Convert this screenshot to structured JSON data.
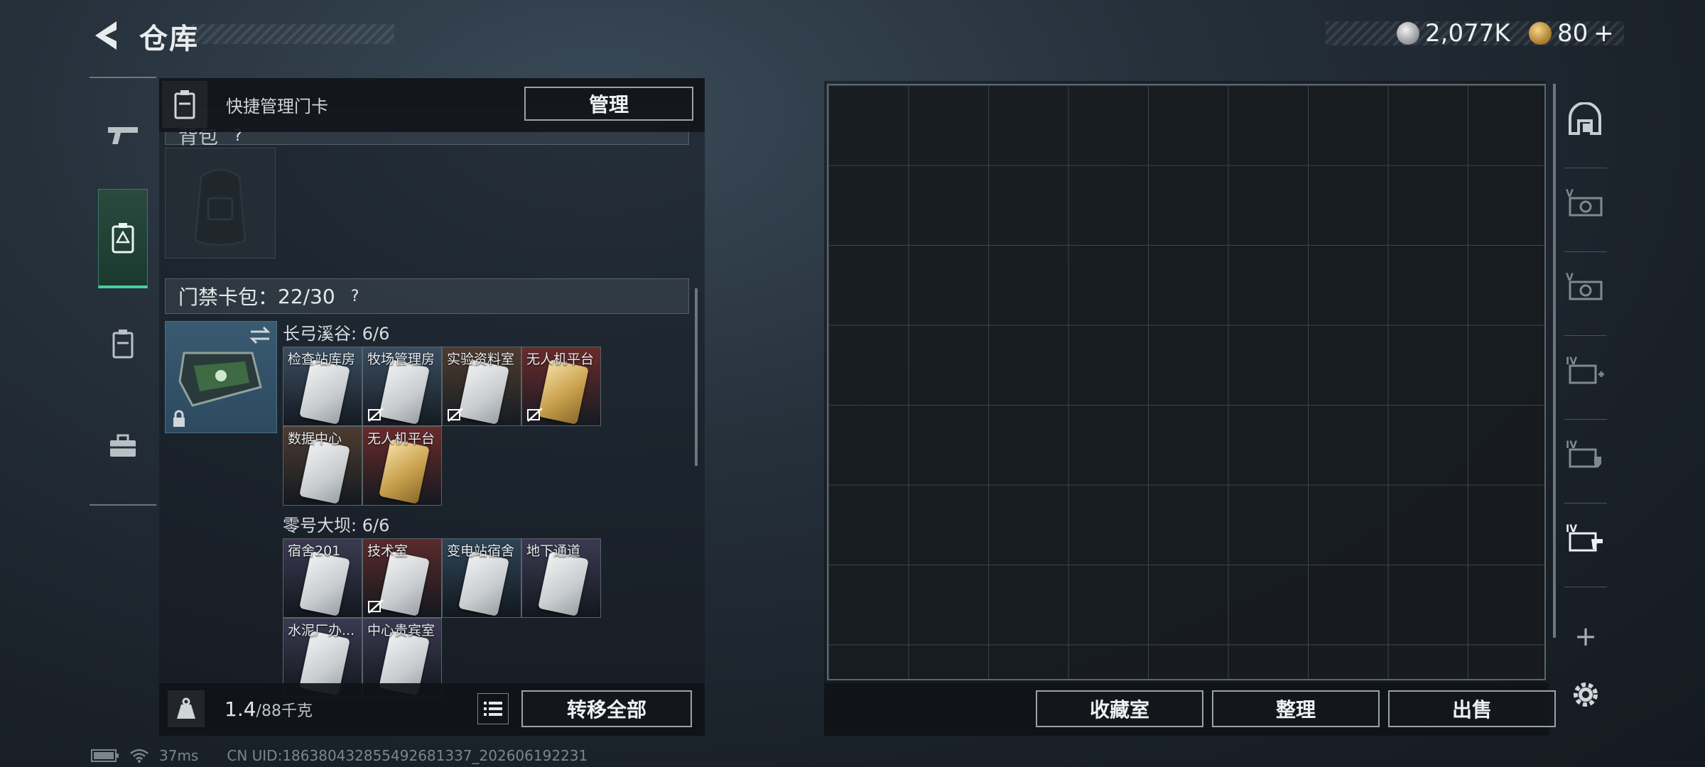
{
  "header": {
    "title": "仓库"
  },
  "currency": {
    "silver": "2,077K",
    "gold": "80",
    "gold_plus": "+"
  },
  "quick_manage": {
    "label": "快捷管理门卡",
    "button": "管理"
  },
  "backpack": {
    "label": "背包",
    "help": "?"
  },
  "keycard_pack": {
    "label": "门禁卡包：",
    "count": "22/30",
    "help": "?",
    "groups": [
      {
        "title": "长弓溪谷: 6/6",
        "cards": [
          {
            "name": "检查站库房",
            "color": "#3a4e62",
            "gold": false,
            "untradable": false
          },
          {
            "name": "牧场管理房",
            "color": "#3a4e62",
            "gold": false,
            "untradable": true
          },
          {
            "name": "实验资料室",
            "color": "#4e3c30",
            "gold": false,
            "untradable": true
          },
          {
            "name": "无人机平台",
            "color": "#6a2a2a",
            "gold": true,
            "untradable": true
          },
          {
            "name": "数据中心",
            "color": "#4e3c30",
            "gold": false,
            "untradable": false
          },
          {
            "name": "无人机平台",
            "color": "#6a2a2a",
            "gold": true,
            "untradable": false
          }
        ]
      },
      {
        "title": "零号大坝: 6/6",
        "cards": [
          {
            "name": "宿舍201",
            "color": "#3c3a52",
            "gold": false,
            "untradable": false
          },
          {
            "name": "技术室",
            "color": "#5a2a2a",
            "gold": false,
            "untradable": true
          },
          {
            "name": "变电站宿舍",
            "color": "#2e4456",
            "gold": false,
            "untradable": false
          },
          {
            "name": "地下通道",
            "color": "#3c3a52",
            "gold": false,
            "untradable": false
          },
          {
            "name": "水泥厂办...",
            "color": "#3c3a52",
            "gold": false,
            "untradable": false
          },
          {
            "name": "中心贵宾室",
            "color": "#3c3a52",
            "gold": false,
            "untradable": false
          }
        ]
      }
    ]
  },
  "weight": {
    "current": "1.4",
    "max": "/88千克"
  },
  "buttons": {
    "transfer_all": "转移全部",
    "collection": "收藏室",
    "sort": "整理",
    "sell": "出售"
  },
  "right_rail": {
    "add": "+"
  },
  "status": {
    "ping": "37ms",
    "uid": "CN UID:18638043285549268133​7_202606192231"
  }
}
